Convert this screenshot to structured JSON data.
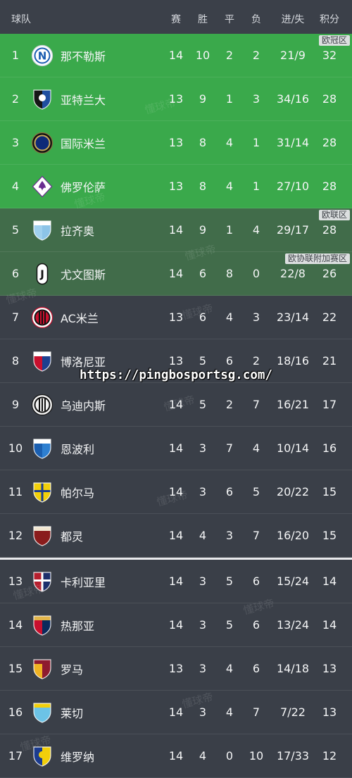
{
  "header": {
    "team": "球队",
    "played": "赛",
    "won": "胜",
    "drawn": "平",
    "lost": "负",
    "goals": "进/失",
    "points": "积分"
  },
  "table": {
    "sections": [
      {
        "rows": [
          {
            "rank": 1,
            "team": "那不勒斯",
            "played": 14,
            "won": 10,
            "drawn": 2,
            "lost": 2,
            "goals": "21/9",
            "points": 32,
            "color": "#3aa94b",
            "zone_label": "欧冠区",
            "logo": {
              "icon": "napoli-logo-icon",
              "colors": [
                "#ffffff",
                "#1b5db1",
                "#c9cfd8"
              ],
              "text": "N"
            }
          },
          {
            "rank": 2,
            "team": "亚特兰大",
            "played": 13,
            "won": 9,
            "drawn": 1,
            "lost": 3,
            "goals": "34/16",
            "points": 28,
            "color": "#3aa94b",
            "logo": {
              "icon": "atalanta-logo-icon",
              "colors": [
                "#161616",
                "#1f4fa0",
                "#ffffff"
              ]
            }
          },
          {
            "rank": 3,
            "team": "国际米兰",
            "played": 13,
            "won": 8,
            "drawn": 4,
            "lost": 1,
            "goals": "31/14",
            "points": 28,
            "color": "#3aa94b",
            "logo": {
              "icon": "inter-logo-icon",
              "colors": [
                "#111111",
                "#c8a95a",
                "#8a7440",
                "#0e2a78"
              ]
            }
          },
          {
            "rank": 4,
            "team": "佛罗伦萨",
            "played": 13,
            "won": 8,
            "drawn": 4,
            "lost": 1,
            "goals": "27/10",
            "points": 28,
            "color": "#3aa94b",
            "logo": {
              "icon": "fiorentina-logo-icon",
              "colors": [
                "#ffffff",
                "#6a2c91",
                "#6a2c91"
              ]
            }
          },
          {
            "rank": 5,
            "team": "拉齐奥",
            "played": 14,
            "won": 9,
            "drawn": 1,
            "lost": 4,
            "goals": "29/17",
            "points": 28,
            "color": "#416c4a",
            "zone_label": "欧联区",
            "logo": {
              "icon": "lazio-logo-icon",
              "colors": [
                "#9fd0ee",
                "#8cc4e8",
                "#ffffff"
              ]
            }
          },
          {
            "rank": 6,
            "team": "尤文图斯",
            "played": 14,
            "won": 6,
            "drawn": 8,
            "lost": 0,
            "goals": "22/8",
            "points": 26,
            "color": "#416c4a",
            "zone_label": "欧协联附加赛区",
            "logo": {
              "icon": "juventus-logo-icon",
              "colors": [
                "#ffffff",
                "#111111"
              ],
              "text": "J"
            }
          },
          {
            "rank": 7,
            "team": "AC米兰",
            "played": 13,
            "won": 6,
            "drawn": 4,
            "lost": 3,
            "goals": "23/14",
            "points": 22,
            "color": "#3a3f48",
            "logo": {
              "icon": "ac-milan-logo-icon",
              "colors": [
                "#ffffff",
                "#111111",
                "#c8102e",
                "#c8102e",
                "#111111"
              ]
            }
          },
          {
            "rank": 8,
            "team": "博洛尼亚",
            "played": 13,
            "won": 5,
            "drawn": 6,
            "lost": 2,
            "goals": "18/16",
            "points": 21,
            "color": "#3a3f48",
            "logo": {
              "icon": "bologna-logo-icon",
              "colors": [
                "#c8102e",
                "#1c3f8f",
                "#ffffff"
              ]
            }
          },
          {
            "rank": 9,
            "team": "乌迪内斯",
            "played": 14,
            "won": 5,
            "drawn": 2,
            "lost": 7,
            "goals": "16/21",
            "points": 17,
            "color": "#3a3f48",
            "logo": {
              "icon": "udinese-logo-icon",
              "colors": [
                "#f2f2f2",
                "#111111",
                "#111111"
              ]
            }
          },
          {
            "rank": 10,
            "team": "恩波利",
            "played": 14,
            "won": 3,
            "drawn": 7,
            "lost": 4,
            "goals": "10/14",
            "points": 16,
            "color": "#3a3f48",
            "logo": {
              "icon": "empoli-logo-icon",
              "colors": [
                "#1b5fb0",
                "#2e7fd0",
                "#ffffff"
              ]
            }
          },
          {
            "rank": 11,
            "team": "帕尔马",
            "played": 14,
            "won": 3,
            "drawn": 6,
            "lost": 5,
            "goals": "20/22",
            "points": 15,
            "color": "#3a3f48",
            "logo": {
              "icon": "parma-logo-icon",
              "colors": [
                "#f2cf0a",
                "#f2cf0a",
                "#1c3c8f"
              ]
            }
          },
          {
            "rank": 12,
            "team": "都灵",
            "played": 14,
            "won": 4,
            "drawn": 3,
            "lost": 7,
            "goals": "16/20",
            "points": 15,
            "color": "#3a3f48",
            "logo": {
              "icon": "torino-logo-icon",
              "colors": [
                "#8a1c1c",
                "#8a1c1c",
                "#f1e6d0"
              ]
            }
          }
        ]
      },
      {
        "rows": [
          {
            "rank": 13,
            "team": "卡利亚里",
            "played": 14,
            "won": 3,
            "drawn": 5,
            "lost": 6,
            "goals": "15/24",
            "points": 14,
            "color": "#3a3f48",
            "logo": {
              "icon": "cagliari-logo-icon",
              "colors": [
                "#b51f2e",
                "#1c2f6b",
                "#ffffff"
              ]
            }
          },
          {
            "rank": 14,
            "team": "热那亚",
            "played": 14,
            "won": 3,
            "drawn": 5,
            "lost": 6,
            "goals": "13/24",
            "points": 14,
            "color": "#3a3f48",
            "logo": {
              "icon": "genoa-logo-icon",
              "colors": [
                "#c8102e",
                "#0b2a5c",
                "#e2b54a"
              ]
            }
          },
          {
            "rank": 15,
            "team": "罗马",
            "played": 13,
            "won": 3,
            "drawn": 4,
            "lost": 6,
            "goals": "14/18",
            "points": 13,
            "color": "#3a3f48",
            "logo": {
              "icon": "roma-logo-icon",
              "colors": [
                "#f0b323",
                "#8e1b2f",
                "#8e1b2f"
              ]
            }
          },
          {
            "rank": 16,
            "team": "莱切",
            "played": 14,
            "won": 3,
            "drawn": 4,
            "lost": 7,
            "goals": "7/22",
            "points": 13,
            "color": "#3a3f48",
            "logo": {
              "icon": "lecce-logo-icon",
              "colors": [
                "#6cc3e6",
                "#6cc3e6",
                "#f2cf0a"
              ]
            }
          },
          {
            "rank": 17,
            "team": "维罗纳",
            "played": 14,
            "won": 4,
            "drawn": 0,
            "lost": 10,
            "goals": "17/33",
            "points": 12,
            "color": "#3a3f48",
            "logo": {
              "icon": "verona-logo-icon",
              "colors": [
                "#1c3c8f",
                "#f2cf0a",
                "#f2cf0a"
              ]
            }
          }
        ]
      }
    ]
  },
  "watermark": "懂球帝",
  "overlay_url": "https://pingbosportsg.com/"
}
